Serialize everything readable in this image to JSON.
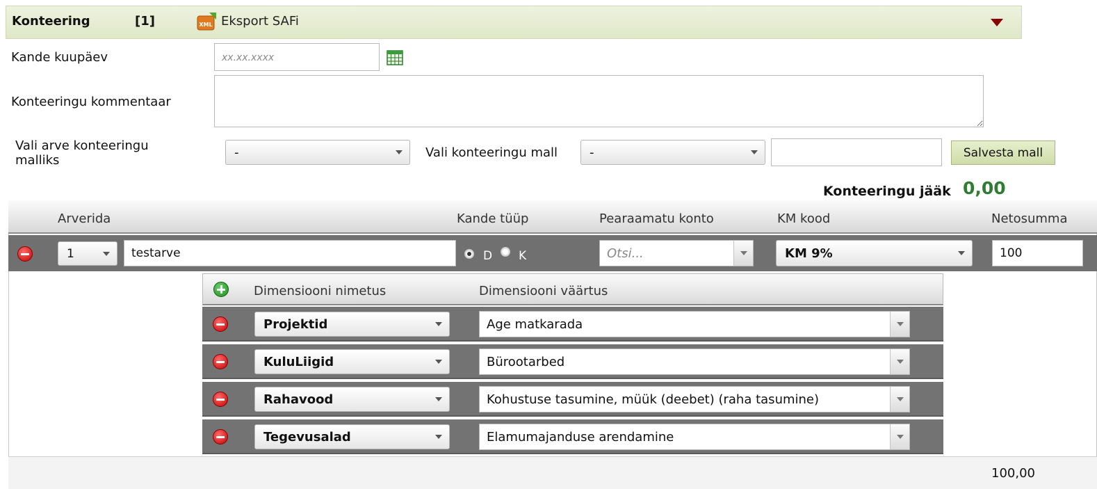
{
  "header": {
    "title": "Konteering",
    "count": "[1]",
    "export_label": "Eksport SAFi",
    "xml_icon_text": "XML"
  },
  "form": {
    "date_label": "Kande kuupäev",
    "date_placeholder": "xx.xx.xxxx",
    "comment_label": "Konteeringu kommentaar",
    "invoice_template_label": "Vali arve konteeringu malliks",
    "invoice_template_value": "-",
    "template_label": "Vali konteeringu mall",
    "template_value": "-",
    "template_name_value": "",
    "save_template_button": "Salvesta mall",
    "balance_label": "Konteeringu jääk",
    "balance_value": "0,00"
  },
  "table": {
    "columns": {
      "rows": "Arverida",
      "entry_type": "Kande tüüp",
      "ledger_account": "Pearaamatu konto",
      "vat_code": "KM kood",
      "net_sum": "Netosumma"
    },
    "row": {
      "row_number": "1",
      "description": "testarve",
      "debit_label": "D",
      "credit_label": "K",
      "selected_type": "D",
      "ledger_placeholder": "Otsi...",
      "vat_code": "KM 9%",
      "net_sum": "100"
    },
    "dimensions": {
      "name_header": "Dimensiooni nimetus",
      "value_header": "Dimensiooni väärtus",
      "rows": [
        {
          "name": "Projektid",
          "value": "Age matkarada"
        },
        {
          "name": "KuluLiigid",
          "value": "Bürootarbed"
        },
        {
          "name": "Rahavood",
          "value": "Kohustuse tasumine, müük (deebet) (raha tasumine)"
        },
        {
          "name": "Tegevusalad",
          "value": "Elamumajanduse arendamine"
        }
      ]
    },
    "total": "100,00"
  },
  "colors": {
    "header_bg": "#e4ebd0",
    "balance_green": "#2e7d32",
    "row_bg": "#707070",
    "remove_red": "#d40000",
    "add_green": "#1f8b1f"
  }
}
